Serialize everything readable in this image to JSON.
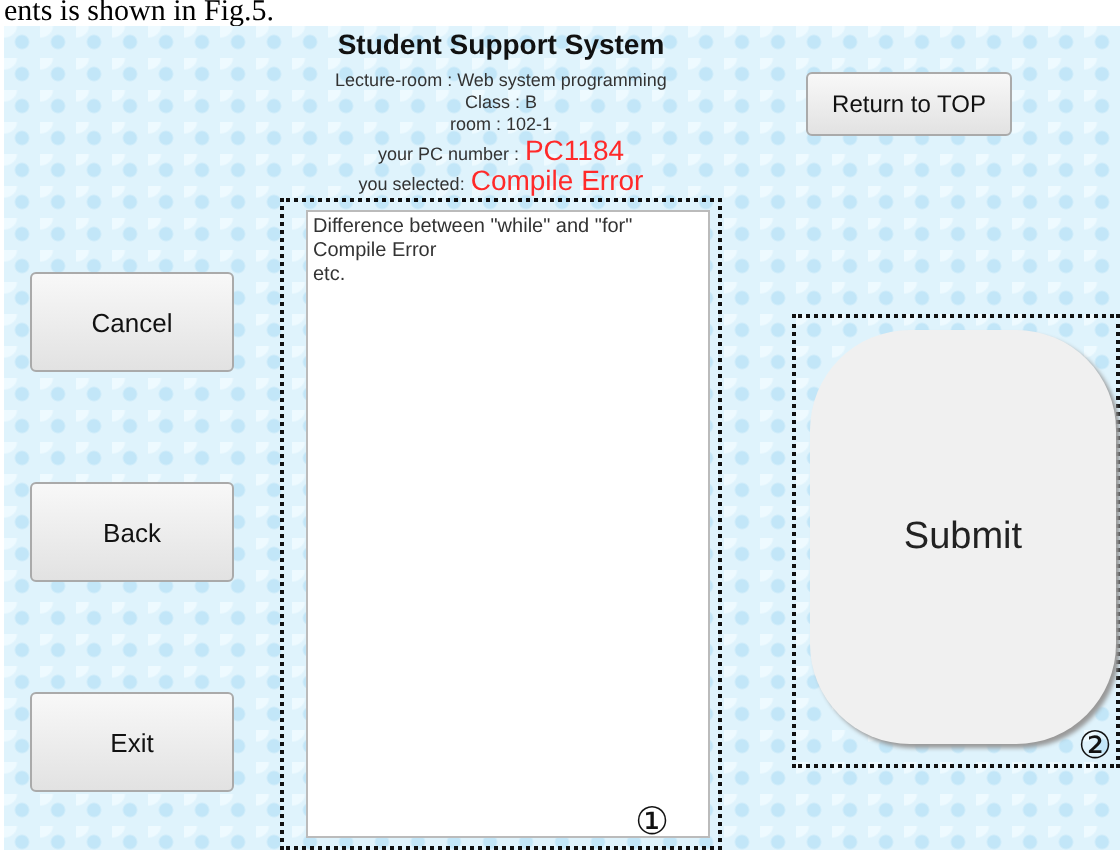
{
  "caption_fragment": "ents is shown in Fig.5.",
  "title": "Student Support System",
  "info_lines": [
    {
      "label": "Lecture-room : Web system programming"
    },
    {
      "label": "Class : B"
    },
    {
      "label": "room : 102-1"
    },
    {
      "label": "your PC number :",
      "value": "PC1184"
    },
    {
      "label": "you selected:",
      "value": "Compile Error"
    }
  ],
  "return_button": "Return to TOP",
  "side_buttons": [
    "Cancel",
    "Back",
    "Exit"
  ],
  "question_box": {
    "value": "Difference between \"while\" and \"for\"\nCompile Error\netc.",
    "marker": "①"
  },
  "submit": {
    "label": "Submit",
    "marker": "②"
  }
}
